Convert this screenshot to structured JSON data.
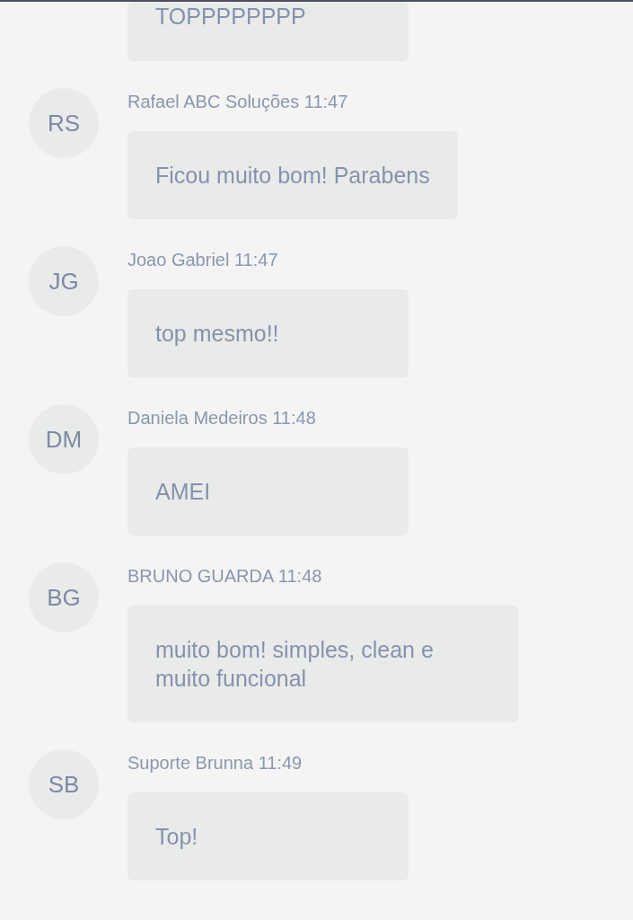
{
  "messages": [
    {
      "text": "TOPPPPPPPP"
    },
    {
      "initials": "RS",
      "author": "Rafael ABC Soluções",
      "time": "11:47",
      "text": "Ficou muito bom! Parabens"
    },
    {
      "initials": "JG",
      "author": "Joao Gabriel",
      "time": "11:47",
      "text": "top mesmo!!"
    },
    {
      "initials": "DM",
      "author": "Daniela Medeiros",
      "time": "11:48",
      "text": "AMEI"
    },
    {
      "initials": "BG",
      "author": "BRUNO GUARDA",
      "time": "11:48",
      "text": "muito bom! simples, clean e muito funcional"
    },
    {
      "initials": "SB",
      "author": "Suporte Brunna",
      "time": "11:49",
      "text": "Top!"
    }
  ]
}
